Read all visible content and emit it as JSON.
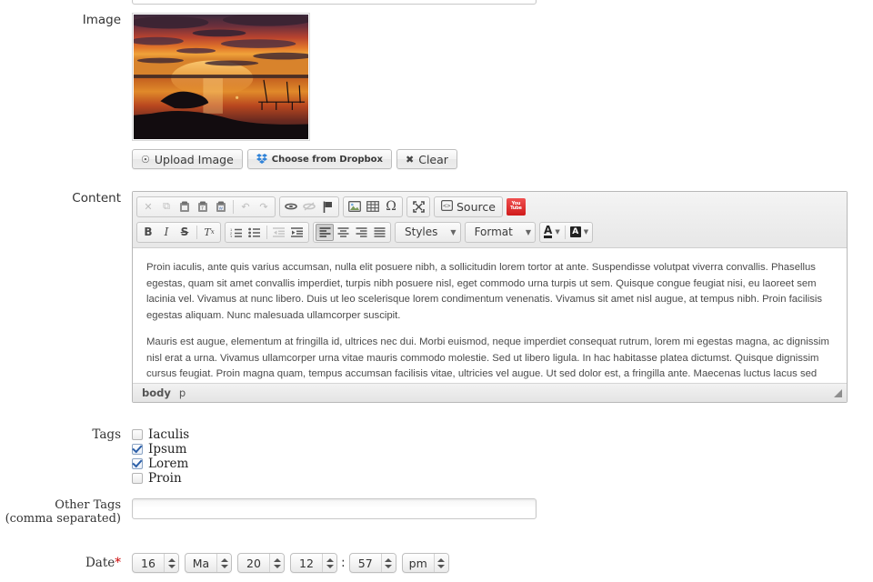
{
  "top_cut_field": {
    "value": "",
    "placeholder": ""
  },
  "image": {
    "label": "Image",
    "alt": "sunset-over-lake-thumbnail",
    "buttons": {
      "upload": "Upload Image",
      "dropbox": "Choose from Dropbox",
      "clear": "Clear"
    },
    "icons": {
      "upload": "upload-icon",
      "dropbox": "dropbox-icon",
      "clear": "close-icon"
    }
  },
  "content": {
    "label": "Content",
    "toolbar_row1": [
      {
        "name": "cut-button",
        "glyph": "✕",
        "dim": true,
        "group": 1
      },
      {
        "name": "copy-button",
        "glyph": "❐",
        "dim": true,
        "group": 1
      },
      {
        "name": "paste-button",
        "glyph": "ὌB",
        "dim": false,
        "group": 1
      },
      {
        "name": "paste-as-plain-text-button",
        "glyph": "ὌB",
        "dim": false,
        "group": 1
      },
      {
        "name": "paste-from-word-button",
        "glyph": "ὌB",
        "dim": false,
        "group": 1
      },
      {
        "name": "undo-button",
        "glyph": "↶",
        "dim": true,
        "group": 1
      },
      {
        "name": "redo-button",
        "glyph": "↷",
        "dim": true,
        "group": 1
      },
      {
        "name": "link-button",
        "glyph": "ὑ7",
        "dim": false,
        "group": 2
      },
      {
        "name": "unlink-button",
        "glyph": "ὑ7",
        "dim": true,
        "group": 2
      },
      {
        "name": "anchor-button",
        "glyph": "⚑",
        "dim": false,
        "group": 2
      },
      {
        "name": "image-button",
        "glyph": "ὛC",
        "dim": false,
        "group": 3
      },
      {
        "name": "table-button",
        "glyph": "▦",
        "dim": false,
        "group": 3
      },
      {
        "name": "special-character-button",
        "glyph": "Ω",
        "dim": false,
        "group": 3
      },
      {
        "name": "maximize-button",
        "glyph": "⤢",
        "dim": false,
        "group": 4
      },
      {
        "name": "source-button",
        "glyph": "Source",
        "dim": false,
        "group": 5
      },
      {
        "name": "youtube-button",
        "glyph": "YouTube",
        "dim": false,
        "group": 6
      }
    ],
    "source_label": "Source",
    "youtube_label": "You Tube",
    "toolbar_row2": [
      {
        "name": "bold-button",
        "glyph": "B",
        "group": 1
      },
      {
        "name": "italic-button",
        "glyph": "I",
        "group": 1
      },
      {
        "name": "strikethrough-button",
        "glyph": "S",
        "group": 1
      },
      {
        "name": "remove-format-button",
        "glyph": "Tx",
        "group": 1
      },
      {
        "name": "numbered-list-button",
        "glyph": "list-ol",
        "group": 2
      },
      {
        "name": "bulleted-list-button",
        "glyph": "list-ul",
        "group": 2
      },
      {
        "name": "outdent-button",
        "glyph": "outdent",
        "group": 2,
        "dim": true
      },
      {
        "name": "indent-button",
        "glyph": "indent",
        "group": 2
      },
      {
        "name": "align-left-button",
        "glyph": "align-left",
        "group": 3,
        "active": true
      },
      {
        "name": "align-center-button",
        "glyph": "align-center",
        "group": 3
      },
      {
        "name": "align-right-button",
        "glyph": "align-right",
        "group": 3
      },
      {
        "name": "align-justify-button",
        "glyph": "align-justify",
        "group": 3
      }
    ],
    "styles_label": "Styles",
    "format_label": "Format",
    "text_color_label": "A",
    "bg_color_label": "A",
    "paragraphs": [
      "Proin iaculis, ante quis varius accumsan, nulla elit posuere nibh, a sollicitudin lorem tortor at ante. Suspendisse volutpat viverra convallis. Phasellus egestas, quam sit amet convallis imperdiet, turpis nibh posuere nisl, eget commodo urna turpis ut sem. Quisque congue feugiat nisi, eu laoreet sem lacinia vel. Vivamus at nunc libero. Duis ut leo scelerisque lorem condimentum venenatis. Vivamus sit amet nisl augue, at tempus nibh. Proin facilisis egestas aliquam. Nunc malesuada ullamcorper suscipit.",
      "Mauris est augue, elementum at fringilla id, ultrices nec dui. Morbi euismod, neque imperdiet consequat rutrum, lorem mi egestas magna, ac dignissim nisl erat a urna. Vivamus ullamcorper urna vitae mauris commodo molestie. Sed ut libero ligula. In hac habitasse platea dictumst. Quisque dignissim cursus feugiat. Proin magna quam, tempus accumsan facilisis vitae, ultricies vel augue. Ut sed dolor est, a fringilla ante. Maecenas luctus lacus sed odio pulvinar eget ultricies nulla iaculis. Vestibulum quis felis et diam placerat dignissim. Vestibulum at dolor nulla. Sed ac massa neque. Nullam sit amet libero"
    ],
    "status_path": [
      "body",
      "p"
    ]
  },
  "tags": {
    "label": "Tags",
    "items": [
      {
        "label": "Iaculis",
        "checked": false
      },
      {
        "label": "Ipsum",
        "checked": true
      },
      {
        "label": "Lorem",
        "checked": true
      },
      {
        "label": "Proin",
        "checked": false
      }
    ]
  },
  "other_tags": {
    "label_line1": "Other Tags",
    "label_line2": "(comma separated)",
    "value": "",
    "placeholder": ""
  },
  "date": {
    "label": "Date",
    "required_marker": "*",
    "day": "16",
    "month": "Ma",
    "year": "20",
    "hour": "12",
    "separator": ":",
    "minute": "57",
    "meridiem": "pm"
  },
  "colors": {
    "required": "#cc0000",
    "checkbox_check": "#2b5fa8",
    "youtube_red": "#d01b1b",
    "toolbar_bg": "#ededed",
    "editor_border": "#b8b8b8"
  }
}
